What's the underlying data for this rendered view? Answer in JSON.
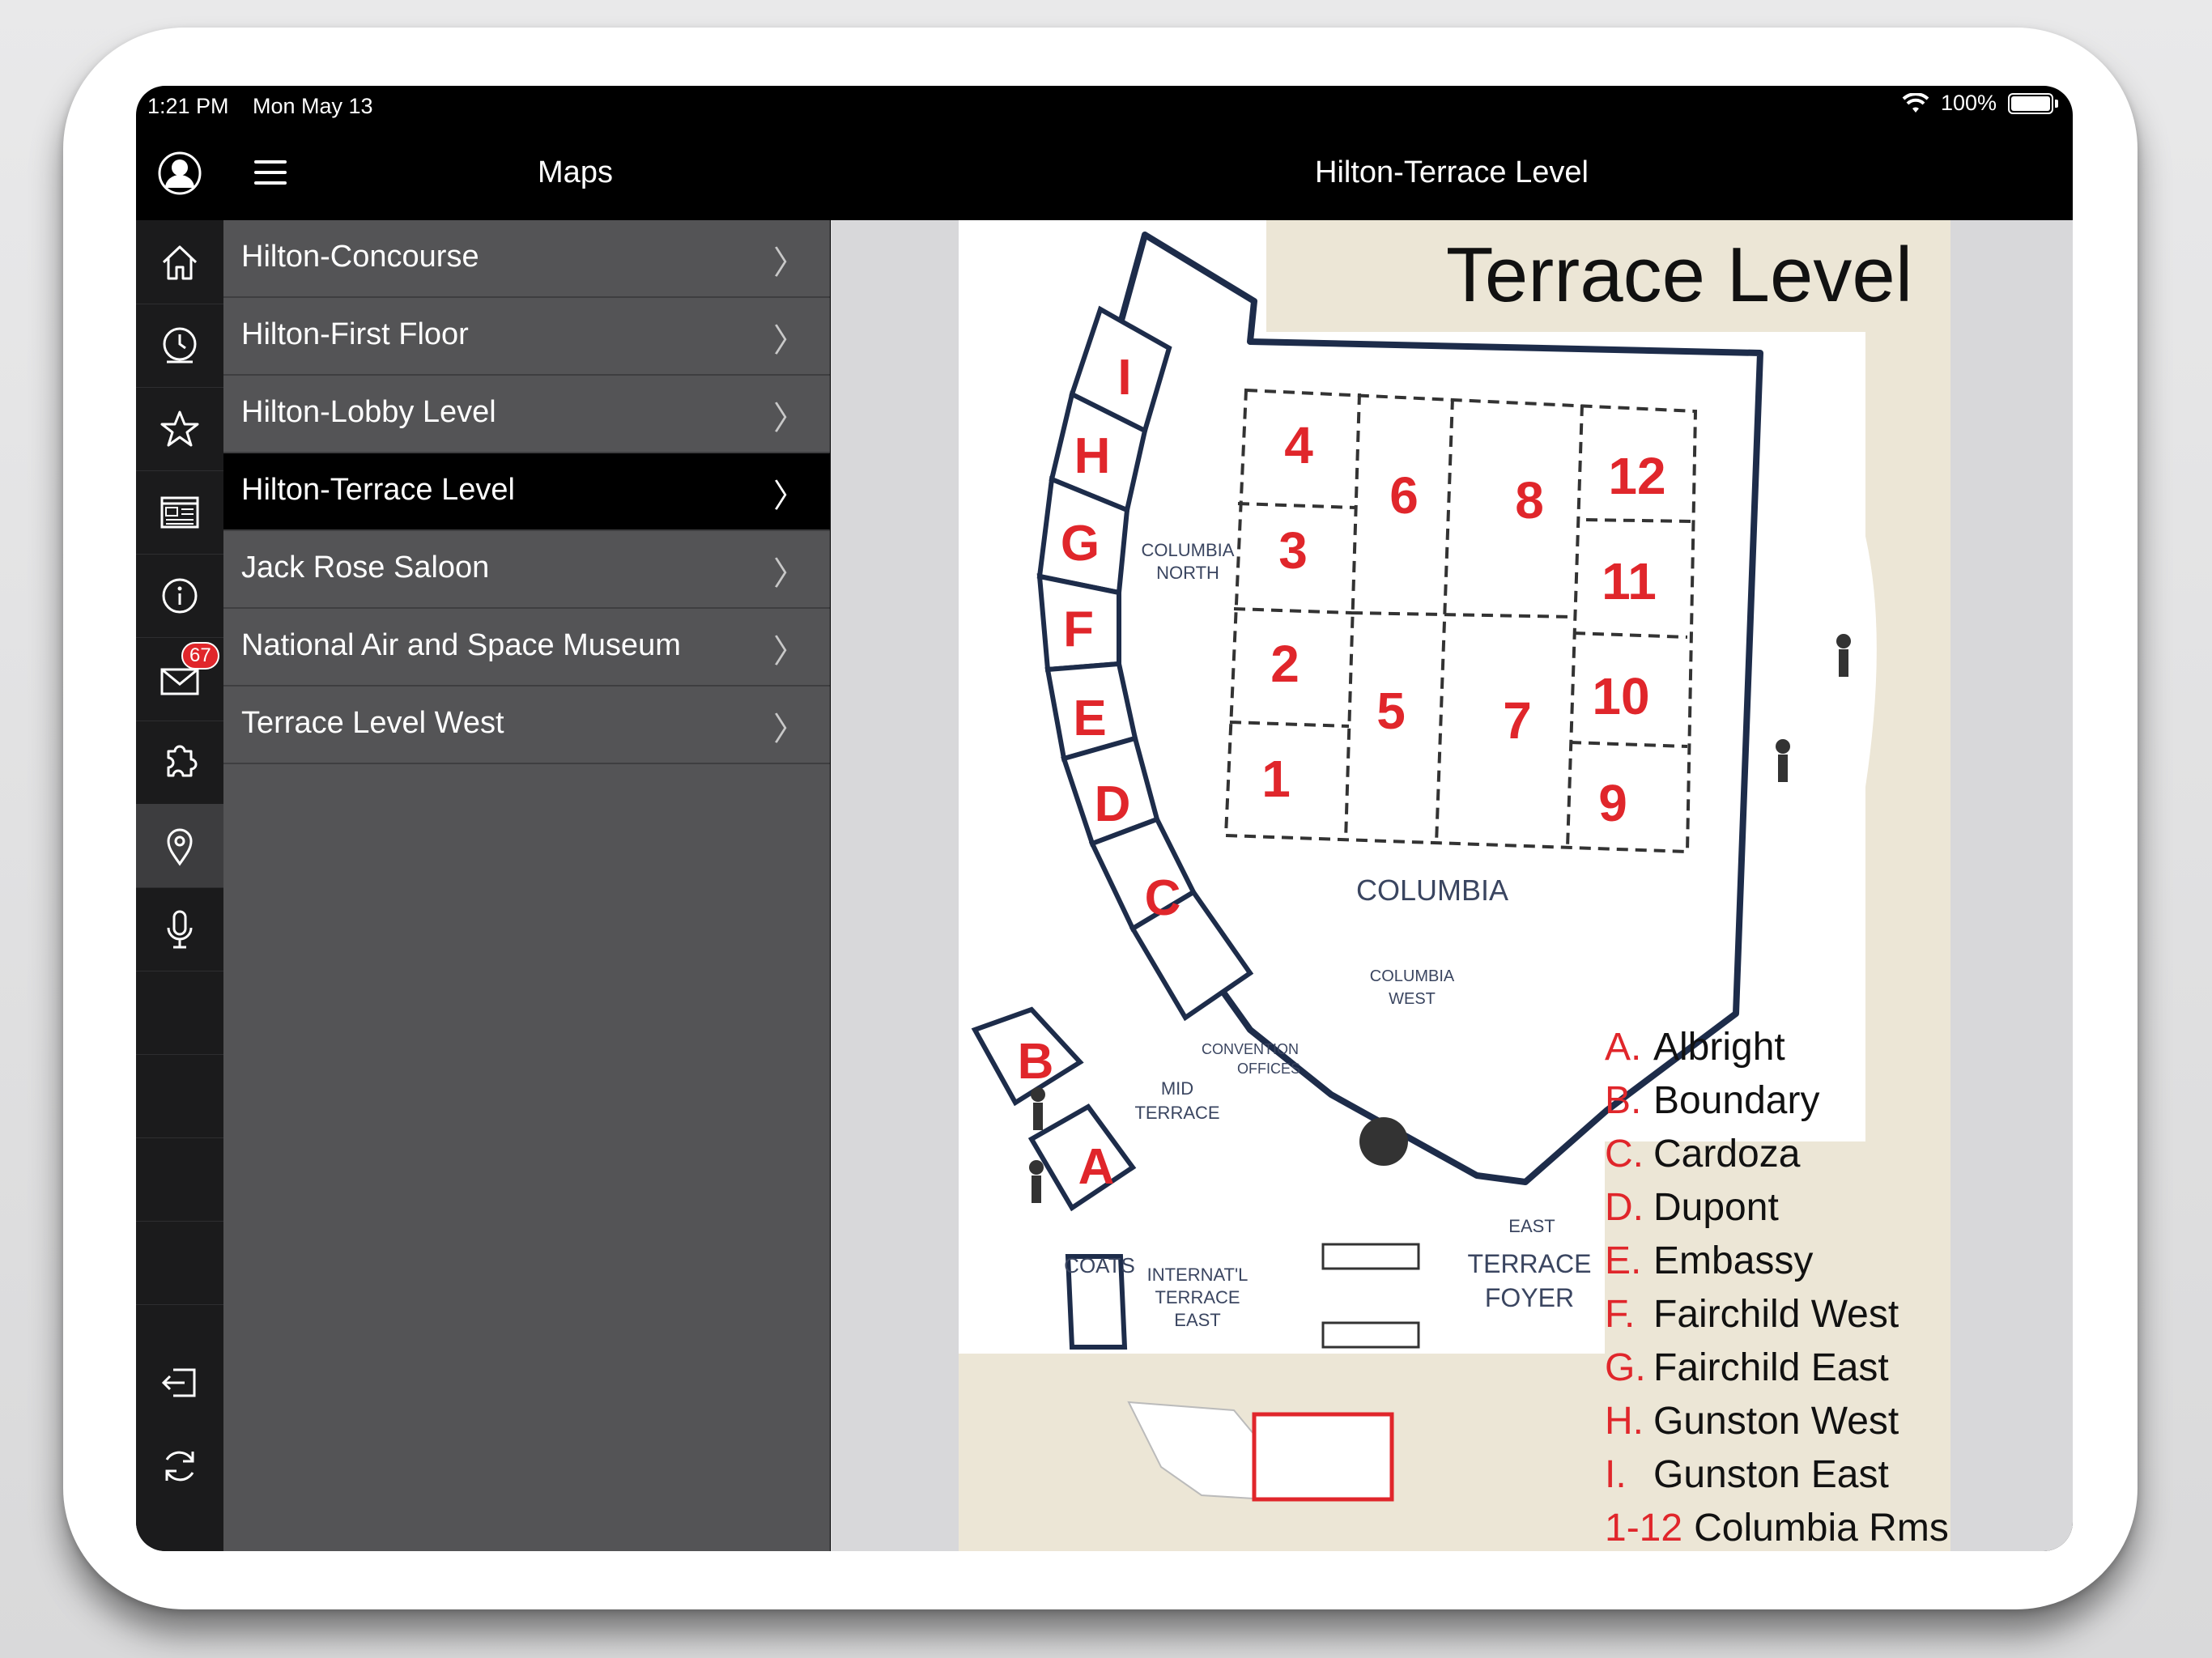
{
  "status_bar": {
    "time": "1:21 PM",
    "date": "Mon May 13",
    "battery": "100%"
  },
  "sidebar_rail": {
    "icons": [
      "user-icon",
      "home-icon",
      "clock-icon",
      "star-icon",
      "newspaper-icon",
      "info-icon",
      "mail-icon",
      "puzzle-icon",
      "map-pin-icon",
      "microphone-icon",
      "logout-icon",
      "refresh-icon"
    ],
    "mail_badge": "67",
    "active": "map-pin-icon"
  },
  "maps_panel": {
    "title": "Maps",
    "items": [
      {
        "label": "Hilton-Concourse"
      },
      {
        "label": "Hilton-First Floor"
      },
      {
        "label": "Hilton-Lobby Level"
      },
      {
        "label": "Hilton-Terrace Level",
        "selected": true
      },
      {
        "label": "Jack Rose Saloon"
      },
      {
        "label": "National Air and Space Museum"
      },
      {
        "label": "Terrace Level West"
      }
    ],
    "chevron": "〉"
  },
  "main": {
    "title": "Hilton-Terrace Level",
    "map": {
      "heading": "Terrace Level",
      "room_letters": [
        "I",
        "H",
        "G",
        "F",
        "E",
        "D",
        "C",
        "B",
        "A"
      ],
      "room_numbers": [
        "4",
        "6",
        "8",
        "12",
        "3",
        "11",
        "2",
        "10",
        "5",
        "7",
        "1",
        "9"
      ],
      "area_labels": {
        "columbia_north_1": "COLUMBIA",
        "columbia_north_2": "NORTH",
        "columbia": "COLUMBIA",
        "columbia_west_1": "COLUMBIA",
        "columbia_west_2": "WEST",
        "convention_1": "CONVENTION",
        "convention_2": "OFFICES",
        "mid_terrace_1": "MID",
        "mid_terrace_2": "TERRACE",
        "coats": "COATS",
        "intl_1": "INTERNAT'L",
        "intl_2": "TERRACE",
        "intl_3": "EAST",
        "east": "EAST",
        "terrace_foyer_1": "TERRACE",
        "terrace_foyer_2": "FOYER"
      },
      "legend": [
        {
          "key": "A.",
          "name": "Albright"
        },
        {
          "key": "B.",
          "name": "Boundary"
        },
        {
          "key": "C.",
          "name": "Cardoza"
        },
        {
          "key": "D.",
          "name": "Dupont"
        },
        {
          "key": "E.",
          "name": "Embassy"
        },
        {
          "key": "F.",
          "name": "Fairchild West"
        },
        {
          "key": "G.",
          "name": "Fairchild East"
        },
        {
          "key": "H.",
          "name": "Gunston West"
        },
        {
          "key": "I.",
          "name": "Gunston East"
        },
        {
          "key": "1-12",
          "name": "Columbia Rms"
        }
      ],
      "colors": {
        "room_text": "#e0262b",
        "outline": "#1d2c4a",
        "beige": "#ece6d6"
      }
    }
  }
}
